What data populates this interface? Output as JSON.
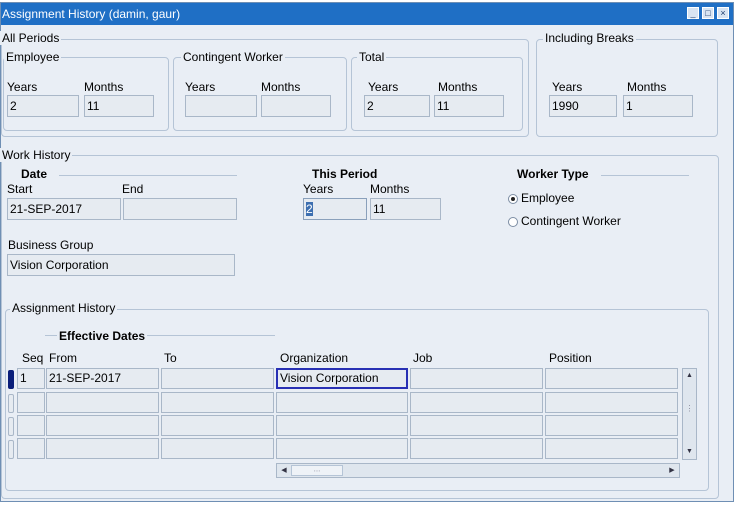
{
  "window": {
    "title": "Assignment History (damin, gaur)"
  },
  "all_periods": {
    "label": "All Periods",
    "employee": {
      "label": "Employee",
      "years_label": "Years",
      "months_label": "Months",
      "years": "2",
      "months": "11"
    },
    "contingent": {
      "label": "Contingent Worker",
      "years_label": "Years",
      "months_label": "Months",
      "years": "",
      "months": ""
    },
    "total": {
      "label": "Total",
      "years_label": "Years",
      "months_label": "Months",
      "years": "2",
      "months": "11"
    }
  },
  "including_breaks": {
    "label": "Including Breaks",
    "years_label": "Years",
    "months_label": "Months",
    "years": "1990",
    "months": "1"
  },
  "work_history": {
    "label": "Work History",
    "date": {
      "label": "Date",
      "start_label": "Start",
      "end_label": "End",
      "start": "21-SEP-2017",
      "end": ""
    },
    "this_period": {
      "label": "This Period",
      "years_label": "Years",
      "months_label": "Months",
      "years": "2",
      "months": "11"
    },
    "worker_type": {
      "label": "Worker Type",
      "options": [
        "Employee",
        "Contingent Worker"
      ],
      "selected": "Employee"
    },
    "business_group": {
      "label": "Business Group",
      "value": "Vision Corporation"
    }
  },
  "assignment_history": {
    "label": "Assignment History",
    "effective_dates_label": "Effective Dates",
    "columns": {
      "seq": "Seq",
      "from": "From",
      "to": "To",
      "organization": "Organization",
      "job": "Job",
      "position": "Position"
    },
    "rows": [
      {
        "seq": "1",
        "from": "21-SEP-2017",
        "to": "",
        "organization": "Vision Corporation",
        "job": "",
        "position": ""
      },
      {
        "seq": "",
        "from": "",
        "to": "",
        "organization": "",
        "job": "",
        "position": ""
      },
      {
        "seq": "",
        "from": "",
        "to": "",
        "organization": "",
        "job": "",
        "position": ""
      },
      {
        "seq": "",
        "from": "",
        "to": "",
        "organization": "",
        "job": "",
        "position": ""
      }
    ]
  }
}
